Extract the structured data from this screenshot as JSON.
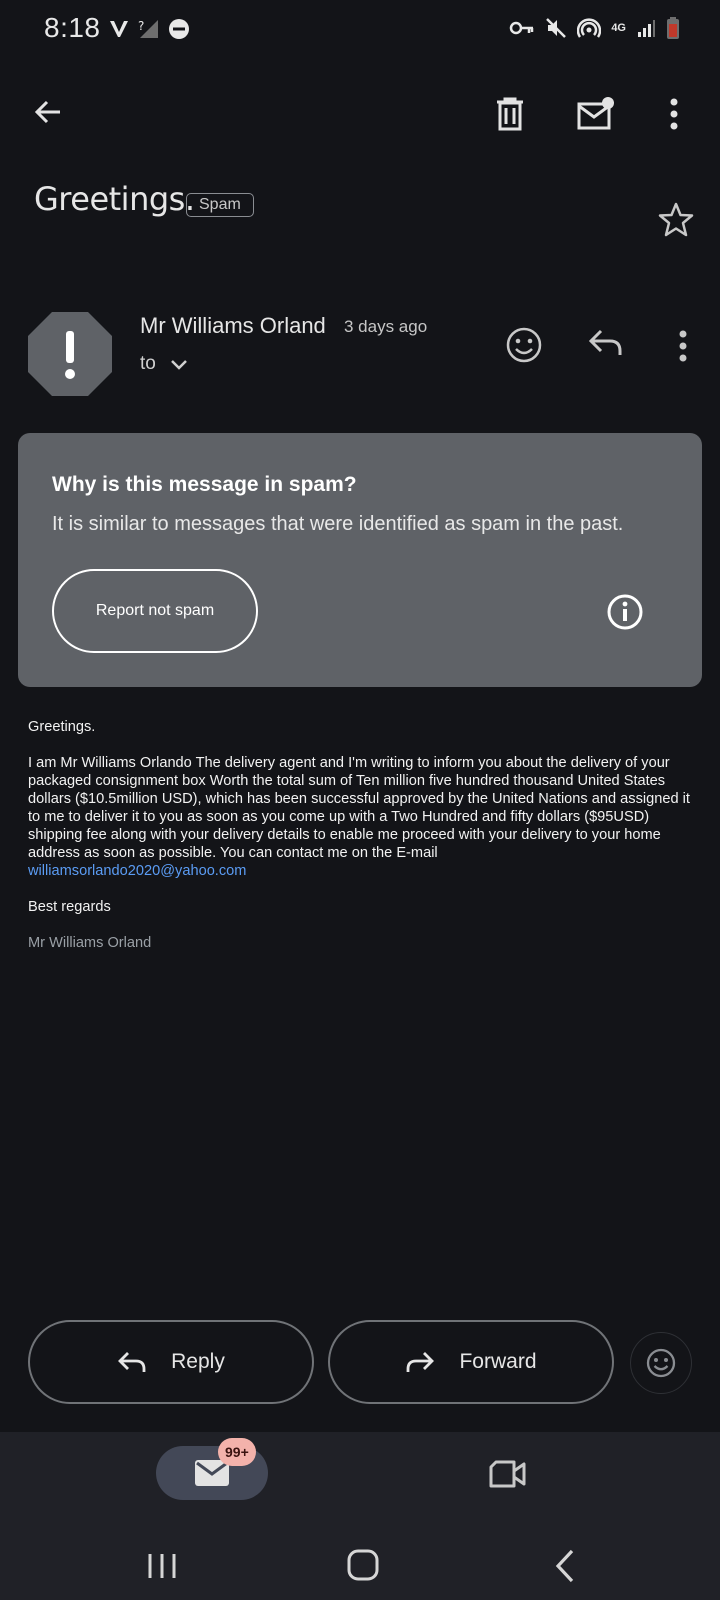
{
  "status_bar": {
    "time": "8:18",
    "left_icons": [
      "wifi-calling-icon",
      "no-signal-icon",
      "do-not-disturb-icon"
    ],
    "right_icons": [
      "vpn-key-icon",
      "mute-icon",
      "hotspot-icon",
      "4g-icon",
      "signal-icon",
      "battery-low-icon"
    ],
    "network": "4G"
  },
  "toolbar": {
    "icons": [
      "back-arrow-icon",
      "delete-icon",
      "mark-unread-icon",
      "more-vert-icon"
    ]
  },
  "email": {
    "subject": "Greetings.",
    "label": "Spam",
    "sender_name": "Mr Williams Orland",
    "time_ago": "3 days ago",
    "to_label": "to",
    "spam_notice": {
      "title": "Why is this message in spam?",
      "description": "It is similar to messages that were identified as spam in the past.",
      "report_button": "Report not spam"
    },
    "body": {
      "greeting": "Greetings.",
      "paragraph": "I am Mr Williams Orlando The delivery agent and I'm writing to inform you about the delivery of your packaged consignment box Worth the total sum of Ten million five hundred thousand United States dollars ($10.5million USD), which has been successful approved by the United Nations and assigned it to me to deliver it to you as soon as you come up with a Two Hundred and fifty dollars ($95USD) shipping fee along with your delivery details to enable me proceed with your delivery to your home address as soon as possible. You can contact me on the E-mail",
      "email_link": "williamsorlando2020@yahoo.com",
      "closing": "Best regards",
      "signature": "Mr Williams Orland"
    }
  },
  "actions": {
    "reply": "Reply",
    "forward": "Forward"
  },
  "bottom_nav": {
    "mail_badge": "99+"
  },
  "colors": {
    "background": "#131418",
    "spam_box": "#5f6267",
    "link": "#5b9cf4",
    "badge": "#f3b2ab",
    "active_tab": "#434857"
  }
}
